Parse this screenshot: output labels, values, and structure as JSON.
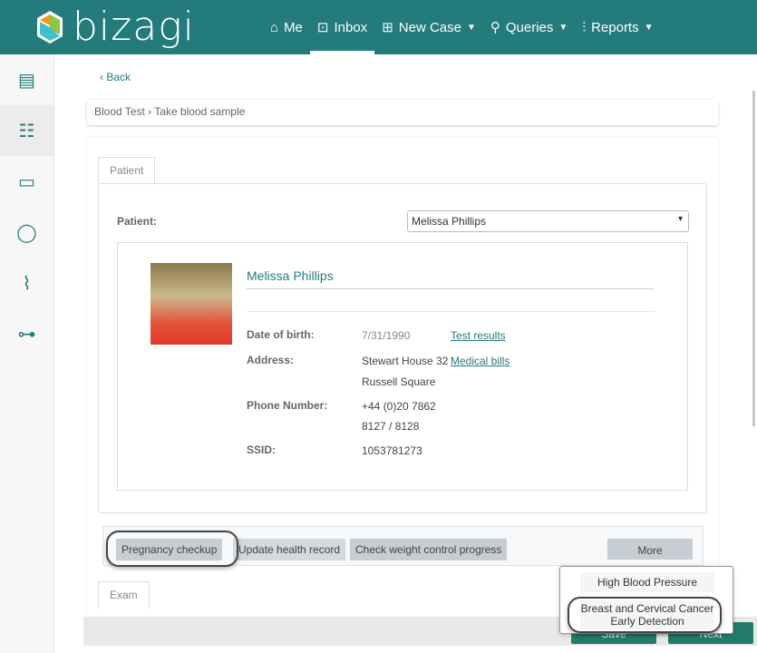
{
  "header": {
    "brand": "bizagi",
    "nav": [
      {
        "label": "Me",
        "icon": "home-icon"
      },
      {
        "label": "Inbox",
        "icon": "inbox-icon",
        "active": true
      },
      {
        "label": "New Case",
        "icon": "new-case-icon",
        "dropdown": true
      },
      {
        "label": "Queries",
        "icon": "search-icon",
        "dropdown": true
      },
      {
        "label": "Reports",
        "icon": "reports-icon",
        "dropdown": true
      }
    ],
    "color": "#237b7b"
  },
  "sidebar": {
    "items": [
      {
        "icon": "form-icon"
      },
      {
        "icon": "list-icon",
        "active": true
      },
      {
        "icon": "folder-icon"
      },
      {
        "icon": "comment-icon"
      },
      {
        "icon": "attachment-icon"
      },
      {
        "icon": "workflow-icon"
      }
    ]
  },
  "back_label": "Back",
  "breadcrumb": "Blood Test › Take blood sample",
  "tabs": {
    "patient": "Patient",
    "exam": "Exam"
  },
  "patient": {
    "label": "Patient:",
    "selected": "Melissa Phillips",
    "name": "Melissa Phillips",
    "fields": {
      "dob_label": "Date of birth:",
      "dob": "7/31/1990",
      "address_label": "Address:",
      "address1": "Stewart House 32",
      "address2": "Russell Square",
      "phone_label": "Phone Number:",
      "phone1": "+44 (0)20 7862",
      "phone2": "8127 / 8128",
      "ssid_label": "SSID:",
      "ssid": "1053781273"
    },
    "links": {
      "test_results": "Test results",
      "medical_bills": "Medical bills"
    }
  },
  "actions": {
    "pregnancy": "Pregnancy checkup",
    "update": "Update health record",
    "weight": "Check weight control progress",
    "more": "More"
  },
  "more_menu": [
    "High Blood Pressure",
    "Breast and Cervical Cancer Early Detection"
  ],
  "footer": {
    "save": "Save",
    "next": "Next"
  }
}
